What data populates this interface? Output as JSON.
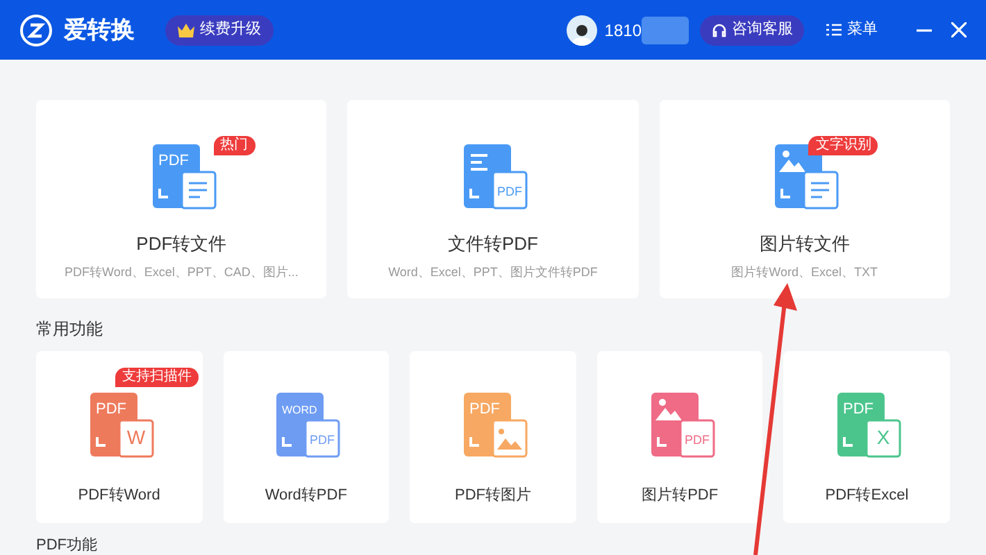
{
  "header": {
    "app_name": "爱转换",
    "upgrade_button": "续费升级",
    "user_phone": "1810",
    "support_button": "咨询客服",
    "menu_button": "菜单"
  },
  "main_tools": [
    {
      "title": "PDF转文件",
      "description": "PDF转Word、Excel、PPT、CAD、图片...",
      "badge": "热门",
      "icon": {
        "color": "#4a9af5",
        "top": {
          "kind": "text",
          "text": "PDF"
        },
        "overlay": {
          "kind": "doc"
        }
      }
    },
    {
      "title": "文件转PDF",
      "description": "Word、Excel、PPT、图片文件转PDF",
      "icon": {
        "color": "#4a9af5",
        "top": {
          "kind": "lines"
        },
        "overlay": {
          "kind": "text",
          "text": "PDF"
        }
      }
    },
    {
      "title": "图片转文件",
      "description": "图片转Word、Excel、TXT",
      "badge": "文字识别",
      "icon": {
        "color": "#4a9af5",
        "top": {
          "kind": "image"
        },
        "overlay": {
          "kind": "doc"
        }
      }
    }
  ],
  "common_section": {
    "title": "常用功能",
    "tools": [
      {
        "title": "PDF转Word",
        "badge": "支持扫描件",
        "icon": {
          "color": "#ee7a5c",
          "top": {
            "kind": "text",
            "text": "PDF"
          },
          "overlay": {
            "kind": "text",
            "text": "W"
          }
        }
      },
      {
        "title": "Word转PDF",
        "icon": {
          "color": "#6e9cf3",
          "top": {
            "kind": "text",
            "text": "WORD"
          },
          "overlay": {
            "kind": "text",
            "text": "PDF"
          }
        }
      },
      {
        "title": "PDF转图片",
        "icon": {
          "color": "#f7a862",
          "top": {
            "kind": "text",
            "text": "PDF"
          },
          "overlay": {
            "kind": "image"
          }
        }
      },
      {
        "title": "图片转PDF",
        "icon": {
          "color": "#ef6b86",
          "top": {
            "kind": "image"
          },
          "overlay": {
            "kind": "text",
            "text": "PDF"
          }
        }
      },
      {
        "title": "PDF转Excel",
        "icon": {
          "color": "#4cc58d",
          "top": {
            "kind": "text",
            "text": "PDF"
          },
          "overlay": {
            "kind": "text",
            "text": "X"
          }
        }
      }
    ]
  },
  "pdf_section": {
    "title": "PDF功能"
  }
}
